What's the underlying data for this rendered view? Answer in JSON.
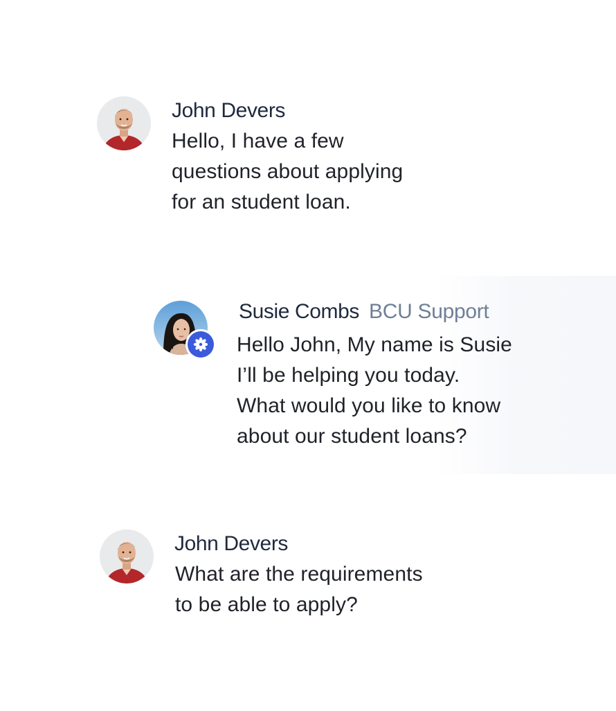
{
  "messages": [
    {
      "author": "John Devers",
      "lines": [
        "Hello, I have a few",
        "questions about applying",
        "for an student loan."
      ]
    },
    {
      "author": "Susie Combs",
      "role": "BCU Support",
      "lines": [
        "Hello John, My name is Susie",
        "I’ll be helping you today.",
        "What would you like to know",
        "about our student loans?"
      ]
    },
    {
      "author": "John Devers",
      "lines": [
        "What are the requirements",
        "to be able to apply?"
      ]
    }
  ],
  "colors": {
    "name": "#1f2a3d",
    "role": "#6e7f97",
    "body": "#1f2228",
    "badge": "#3b5bdb"
  },
  "icons": {
    "user_avatar": "male-avatar-photo",
    "agent_avatar": "female-avatar-photo",
    "agent_badge": "flower-logo-icon"
  }
}
